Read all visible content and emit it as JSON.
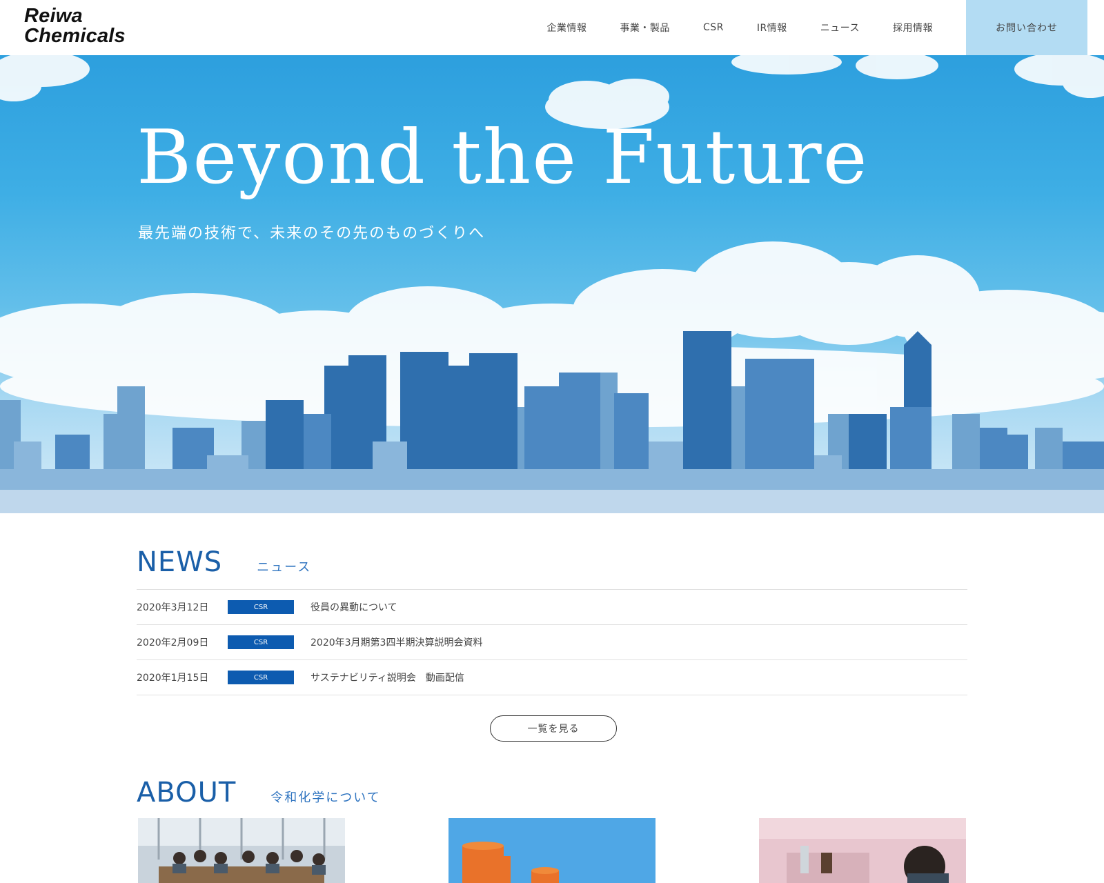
{
  "header": {
    "logo_line1": "Reiwa",
    "logo_line2": "Chemicals",
    "nav": [
      {
        "label": "企業情報"
      },
      {
        "label": "事業・製品"
      },
      {
        "label": "CSR"
      },
      {
        "label": "IR情報"
      },
      {
        "label": "ニュース"
      },
      {
        "label": "採用情報"
      }
    ],
    "contact_label": "お問い合わせ"
  },
  "hero": {
    "title": "Beyond the Future",
    "subtitle": "最先端の技術で、未来のその先のものづくりへ"
  },
  "news": {
    "heading_en": "NEWS",
    "heading_ja": "ニュース",
    "items": [
      {
        "date": "2020年3月12日",
        "category": "CSR",
        "title": "役員の異動について"
      },
      {
        "date": "2020年2月09日",
        "category": "CSR",
        "title": "2020年3月期第3四半期決算説明会資料"
      },
      {
        "date": "2020年1月15日",
        "category": "CSR",
        "title": "サステナビリティ説明会　動画配信"
      }
    ],
    "more_label": "一覧を見る"
  },
  "about": {
    "heading_en": "ABOUT",
    "heading_ja": "令和化学について"
  },
  "colors": {
    "accent": "#1a5fa8",
    "badge": "#0d5bb0",
    "contact_bg": "#b3dcf3"
  }
}
